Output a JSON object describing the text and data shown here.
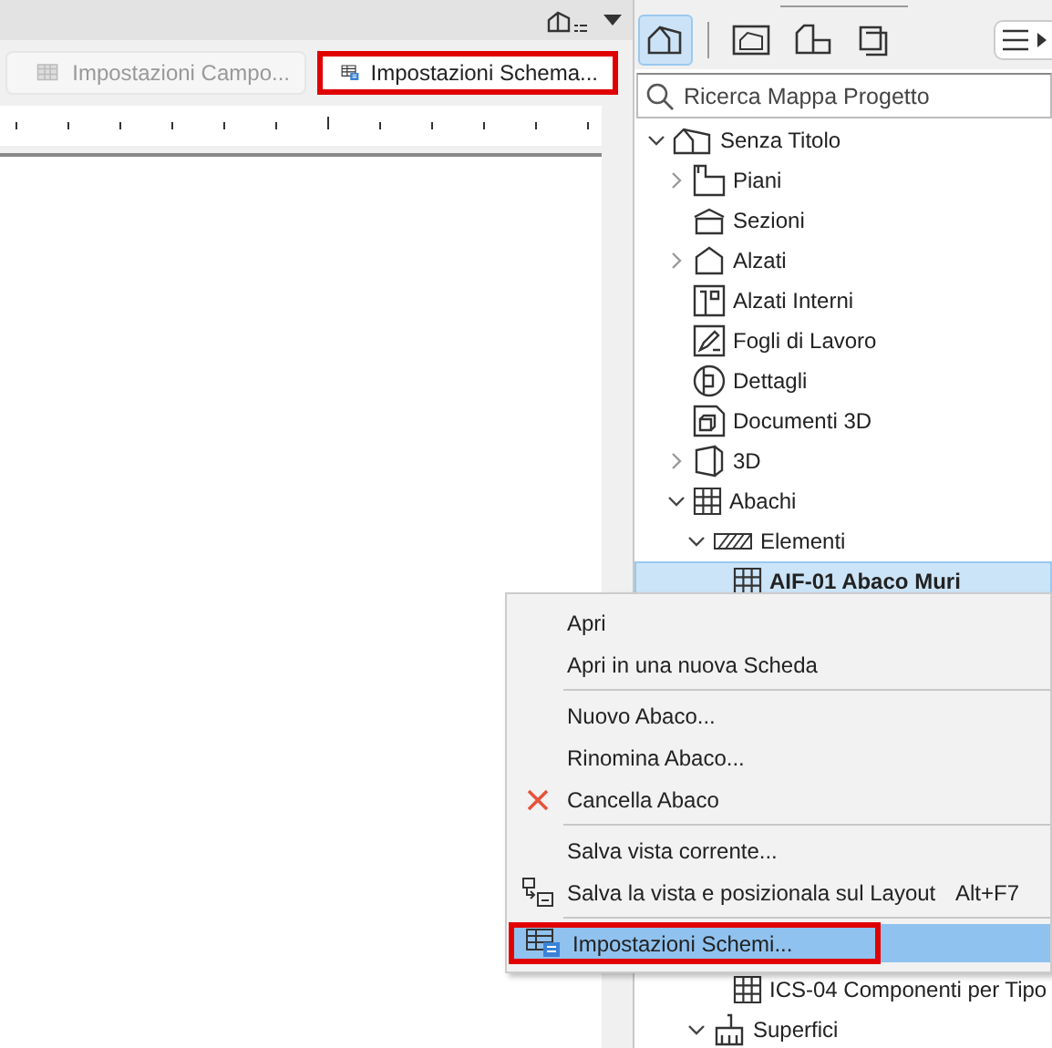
{
  "view_bar": {
    "tabs": [
      {
        "label": "Impostazioni Campo...",
        "disabled": true,
        "highlighted": false
      },
      {
        "label": "Impostazioni Schema...",
        "disabled": false,
        "highlighted": true
      }
    ]
  },
  "navigator": {
    "toolbar": [
      {
        "selected": true
      },
      {
        "selected": false
      },
      {
        "selected": false
      },
      {
        "selected": false
      }
    ],
    "search": {
      "placeholder": "Ricerca Mappa Progetto"
    },
    "tree": [
      {
        "label": "Senza Titolo",
        "expanded": true,
        "selected": false,
        "children": [
          {
            "label": "Piani",
            "expanded": false,
            "selected": false
          },
          {
            "label": "Sezioni",
            "selected": false
          },
          {
            "label": "Alzati",
            "expanded": false,
            "selected": false
          },
          {
            "label": "Alzati Interni",
            "selected": false
          },
          {
            "label": "Fogli di Lavoro",
            "selected": false
          },
          {
            "label": "Dettagli",
            "selected": false
          },
          {
            "label": "Documenti 3D",
            "selected": false
          },
          {
            "label": "3D",
            "expanded": false,
            "selected": false
          },
          {
            "label": "Abachi",
            "expanded": true,
            "selected": false,
            "children": [
              {
                "label": "Elementi",
                "expanded": true,
                "selected": false,
                "children": [
                  {
                    "label": "AIF-01 Abaco Muri",
                    "selected": true
                  },
                  {
                    "label": "ICS-04 Componenti per Tipo",
                    "selected": false
                  }
                ]
              },
              {
                "label": "Superfici",
                "expanded": true,
                "selected": false
              }
            ]
          }
        ]
      }
    ]
  },
  "context_menu": {
    "items": [
      {
        "kind": "item",
        "label": "Apri",
        "selected": false,
        "highlighted": false
      },
      {
        "kind": "item",
        "label": "Apri in una nuova Scheda",
        "selected": false,
        "highlighted": false
      },
      {
        "kind": "separator"
      },
      {
        "kind": "item",
        "label": "Nuovo Abaco...",
        "selected": false,
        "highlighted": false
      },
      {
        "kind": "item",
        "label": "Rinomina Abaco...",
        "selected": false,
        "highlighted": false
      },
      {
        "kind": "item",
        "label": "Cancella Abaco",
        "selected": false,
        "highlighted": false
      },
      {
        "kind": "separator"
      },
      {
        "kind": "item",
        "label": "Salva vista corrente...",
        "selected": false,
        "highlighted": false
      },
      {
        "kind": "item",
        "label": "Salva la vista e posizionala sul Layout",
        "shortcut": "Alt+F7",
        "selected": false,
        "highlighted": false
      },
      {
        "kind": "separator"
      },
      {
        "kind": "item",
        "label": "Impostazioni Schemi...",
        "selected": true,
        "highlighted": true
      }
    ]
  }
}
